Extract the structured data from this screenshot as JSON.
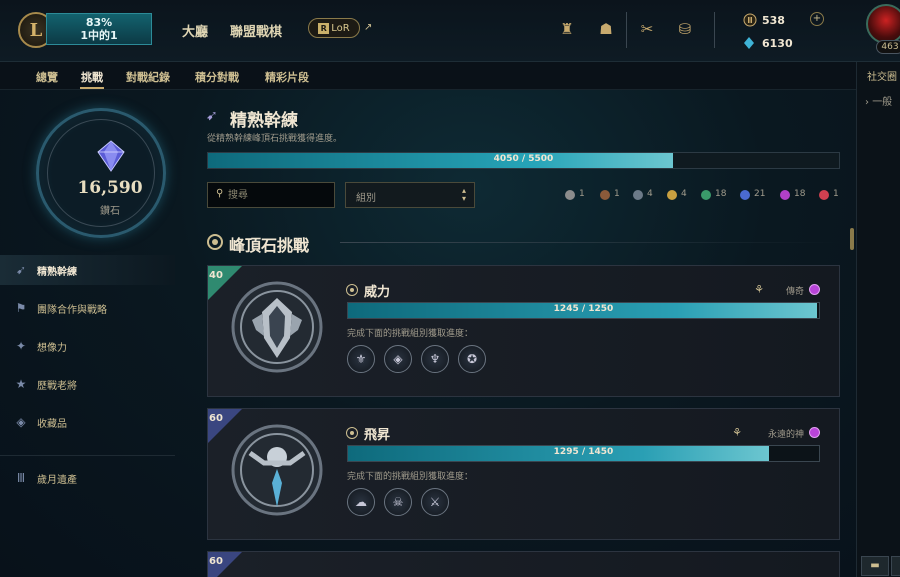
{
  "topbar": {
    "play_percent": "83%",
    "play_sub": "1中的1",
    "nav": [
      "大廳",
      "聯盟戰棋"
    ],
    "lor_label": "LoR",
    "lor_box": "R",
    "currency": {
      "rp": "538",
      "be": "6130"
    },
    "level": "463"
  },
  "subnav": [
    "總覽",
    "挑戰",
    "對戰紀錄",
    "積分對戰",
    "精彩片段"
  ],
  "social": {
    "title": "社交圈",
    "item": "一般"
  },
  "crystal": {
    "value": "16,590",
    "label": "鑽石"
  },
  "sidebar": [
    {
      "label": "精熟幹練",
      "icon": "wing-icon"
    },
    {
      "label": "團隊合作與戰略",
      "icon": "flag-icon"
    },
    {
      "label": "想像力",
      "icon": "star-swirl-icon"
    },
    {
      "label": "歷戰老將",
      "icon": "star-icon"
    },
    {
      "label": "收藏品",
      "icon": "stack-icon"
    },
    {
      "label": "歲月遺產",
      "icon": "pillars-icon"
    }
  ],
  "main": {
    "title": "精熟幹練",
    "description": "從精熟幹練峰頂石挑戰獲得進度。",
    "progress_text": "4050 / 5500",
    "progress_fraction": 0.7364,
    "search_placeholder": "搜尋",
    "group_label": "組別",
    "tier_counts": [
      {
        "count": "1",
        "color": "#8c8c8c"
      },
      {
        "count": "1",
        "color": "#8a5a3a"
      },
      {
        "count": "4",
        "color": "#6c7a88"
      },
      {
        "count": "4",
        "color": "#c9a040"
      },
      {
        "count": "18",
        "color": "#3a9a6a"
      },
      {
        "count": "21",
        "color": "#4a6ad0"
      },
      {
        "count": "18",
        "color": "#b040c8"
      },
      {
        "count": "1",
        "color": "#d04050"
      }
    ],
    "section_title": "峰頂石挑戰"
  },
  "cards": [
    {
      "badge": "40",
      "title": "威力",
      "reward": "傳奇",
      "progress_text": "1245 / 1250",
      "progress_fraction": 0.996,
      "subtitle": "完成下面的挑戰組別獲取進度："
    },
    {
      "badge": "60",
      "title": "飛昇",
      "reward": "永遠的神",
      "progress_text": "1295 / 1450",
      "progress_fraction": 0.893,
      "subtitle": "完成下面的挑戰組別獲取進度："
    }
  ]
}
